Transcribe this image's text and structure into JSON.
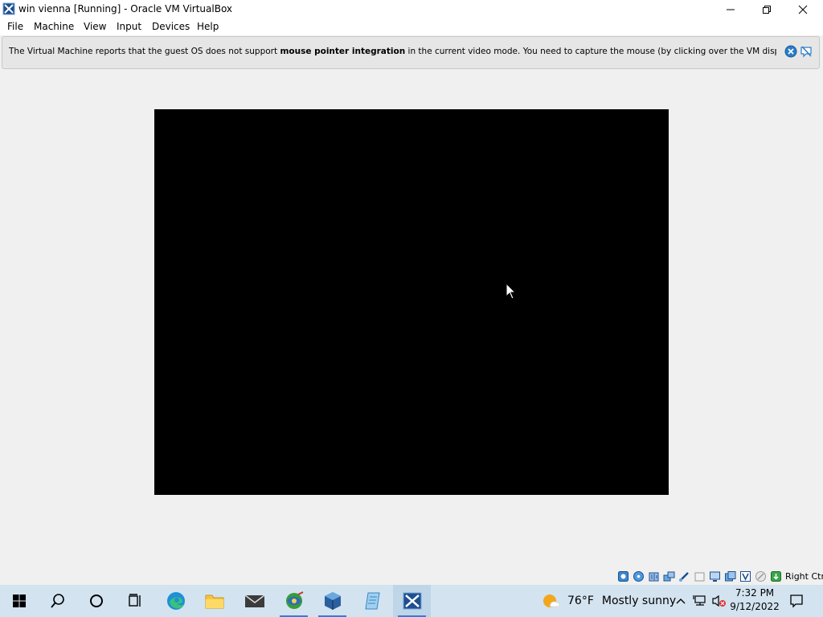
{
  "window": {
    "title": "win vienna [Running] - Oracle VM VirtualBox",
    "controls": {
      "minimize_icon": "minimize-icon",
      "restore_icon": "restore-icon",
      "close_icon": "close-icon"
    }
  },
  "menu": {
    "items": [
      {
        "label": "File"
      },
      {
        "label": "Machine"
      },
      {
        "label": "View"
      },
      {
        "label": "Input"
      },
      {
        "label": "Devices"
      },
      {
        "label": "Help"
      }
    ]
  },
  "notification": {
    "text_before": "The Virtual Machine reports that the guest OS does not support ",
    "text_bold": "mouse pointer integration",
    "text_after": " in the current video mode. You need to capture the mouse (by clicking over the VM display or pressing",
    "accent": "#2a7dc9"
  },
  "vm_display": {
    "background": "#000000"
  },
  "statusbar": {
    "icons": [
      "hard-disk-icon",
      "optical-disk-icon",
      "audio-icon",
      "network-icon",
      "usb-icon",
      "shared-folders-icon",
      "display-icon",
      "recording-icon",
      "virtualization-icon",
      "mouse-integration-icon",
      "host-key-icon"
    ],
    "host_key_label": "Right Ctrl"
  },
  "taskbar": {
    "apps": [
      "start-icon",
      "search-icon",
      "cortana-icon",
      "task-view-icon",
      "edge-icon",
      "file-explorer-icon",
      "mail-icon",
      "network-app-icon",
      "virtualbox-icon",
      "notepad-icon",
      "vista-vm-icon"
    ],
    "weather": {
      "temp": "76°F",
      "condition": "Mostly sunny"
    },
    "clock": {
      "time": "7:32 PM",
      "date": "9/12/2022"
    }
  }
}
